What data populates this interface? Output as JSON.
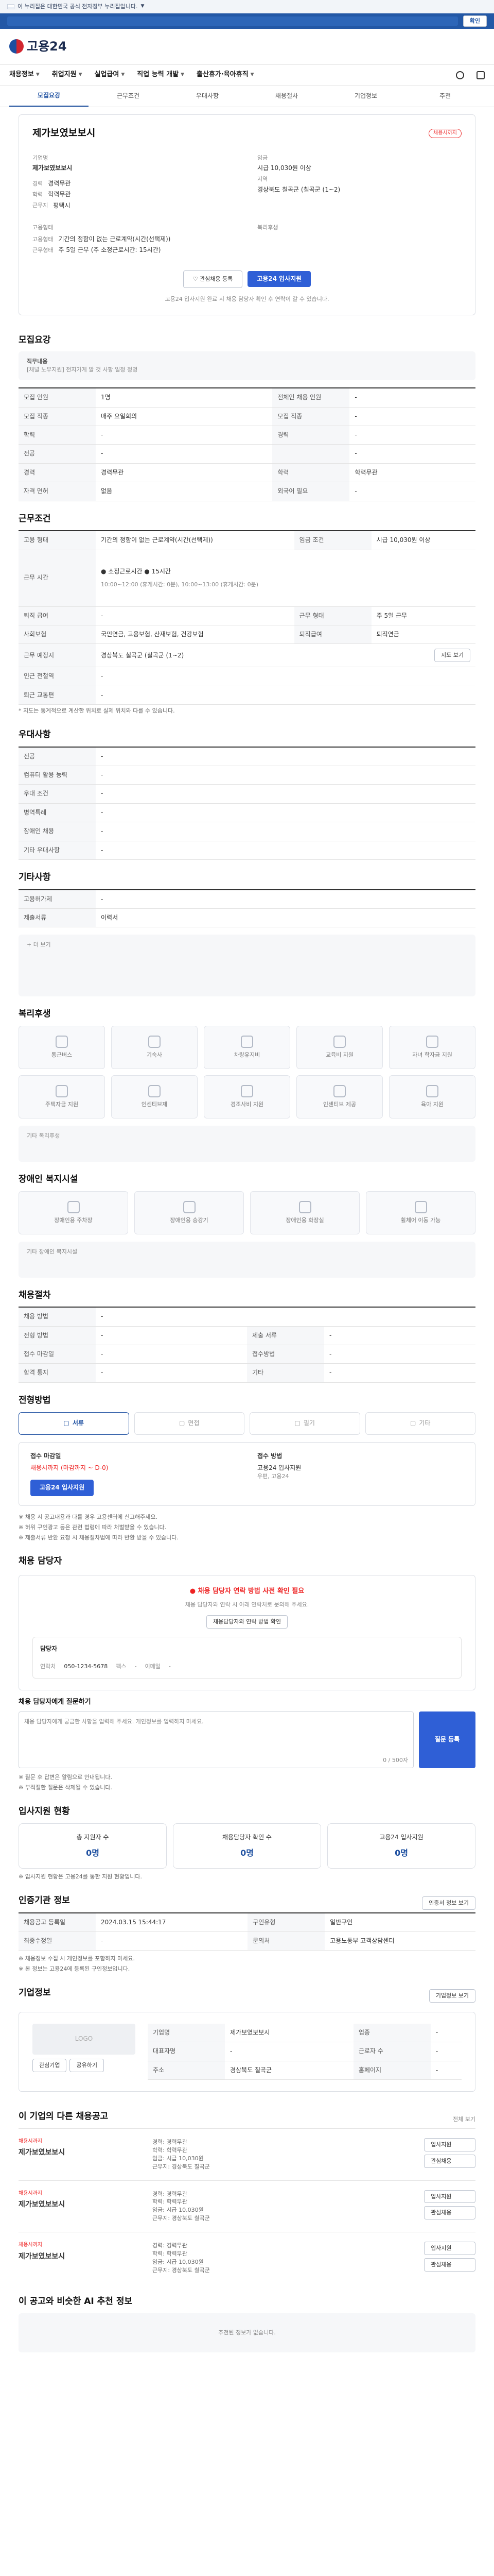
{
  "gov": {
    "banner": "이 누리집은 대한민국 공식 전자정부 누리집입니다.",
    "top_btn": "확인"
  },
  "brand": {
    "name": "고용24"
  },
  "gnb": {
    "items": [
      "채용정보",
      "취업지원",
      "실업급여",
      "직업 능력 개발",
      "출산휴가·육아휴직"
    ]
  },
  "tabs": [
    "모집요강",
    "근무조건",
    "우대사항",
    "채용절차",
    "기업정보",
    "추천"
  ],
  "job": {
    "badge": "채용시까지",
    "title": "제가보였보보시",
    "company_label": "기업명",
    "company": "제가보였보보시",
    "info": [
      [
        "경력",
        "경력무관"
      ],
      [
        "학력",
        "학력무관"
      ],
      [
        "근무지",
        "평택시"
      ]
    ],
    "salary_label": "임금",
    "salary": "시급 10,030원 이상",
    "region_label": "지역",
    "region": "경상북도 칠곡군 (칠곡군 (1~2)",
    "employ_label": "고용형태",
    "employ": [
      [
        "고용형태",
        "기간의 정함이 없는 근로계약(시간(선택제))"
      ],
      [
        "근무형태",
        "주 5일 근무 (주 소정근로시간: 15시간)"
      ]
    ],
    "manager_label": "복리후생",
    "btn_fav": "관심채용 등록",
    "btn_apply": "고용24 입사지원",
    "foot": "고용24 입사지원 완료 시 채용 담당자 확인 후 연락이 갈 수 있습니다."
  },
  "sec_recruit": {
    "title": "모집요강",
    "duty_label": "직무내용",
    "duty_text": "[채널 노무지원] 전지가게 알 것 사항 일정 정명",
    "rows": [
      [
        "모집 인원",
        "1명",
        "전체인 채용 인원",
        "-"
      ],
      [
        "모집 직종",
        "매주 요일희의",
        "모집 직종",
        "-"
      ],
      [
        "학력",
        "-",
        "경력",
        "-"
      ],
      [
        "전공",
        "-",
        "",
        "-"
      ],
      [
        "경력",
        "경력무관",
        "학력",
        "학력무관"
      ],
      [
        "자격 면허",
        "없음",
        "외국어 필요",
        "-"
      ]
    ]
  },
  "sec_cond": {
    "title": "근무조건",
    "rows": [
      [
        "고용 형태",
        "기간의 정함이 없는 근로계약(시간(선택제))",
        "임금 조건",
        "시급 10,030원 이상"
      ],
      [
        "근무 시간",
        "",
        "",
        ""
      ],
      [
        "퇴직 급여",
        "-",
        "근무 형태",
        "주 5일 근무"
      ],
      [
        "사회보험",
        "국민연금, 고용보험, 산재보험, 건강보험",
        "퇴직급여",
        "퇴직연금"
      ],
      [
        "근무 예정지",
        "경상북도 칠곡군 (칠곡군 (1~2)",
        "",
        ""
      ],
      [
        "인근 전철역",
        "-",
        "",
        ""
      ],
      [
        "퇴근 교통편",
        "-",
        "",
        ""
      ]
    ],
    "time": "● 소정근로시간 ● 15시간",
    "work": "10:00~12:00 (휴게시간: 0분), 10:00~13:00 (휴게시간: 0분)",
    "map_btn": "지도 보기",
    "note": "* 지도는 통계적으로 계산한 위치로 실제 위치와 다를 수 있습니다."
  },
  "sec_pref": {
    "title": "우대사항",
    "rows": [
      [
        "전공",
        "-"
      ],
      [
        "컴퓨터 활용 능력",
        "-"
      ],
      [
        "우대 조건",
        "-"
      ],
      [
        "병역특례",
        "-"
      ],
      [
        "장애인 채용",
        "-"
      ],
      [
        "기타 우대사항",
        "-"
      ]
    ]
  },
  "sec_etc": {
    "title": "기타사항",
    "rows": [
      [
        "고용허가제",
        "-"
      ],
      [
        "제출서류",
        "이력서"
      ]
    ],
    "more": "더 보기"
  },
  "sec_welf": {
    "title": "복리후생",
    "items": [
      "통근버스",
      "기숙사",
      "차량유지비",
      "교육비 지원",
      "자녀 학자금 지원",
      "주택자금 지원",
      "인센티브제",
      "경조사비 지원",
      "인센티브 제공",
      "육아 지원"
    ],
    "none": "기타 복리후생"
  },
  "sec_dis": {
    "title": "장애인 복지시설",
    "items": [
      "장애인용 주차장",
      "장애인용 승강기",
      "장애인용 화장실",
      "휠체어 이동 가능"
    ],
    "none": "기타 장애인 복지시설"
  },
  "sec_sel": {
    "title": "채용절차",
    "rows": [
      [
        "채용 방법",
        "-",
        "",
        ""
      ],
      [
        "전형 방법",
        "-",
        "제출 서류",
        "-"
      ],
      [
        "접수 마감일",
        "-",
        "접수방법",
        "-"
      ],
      [
        "합격 통지",
        "-",
        "기타",
        "-"
      ]
    ]
  },
  "sec_apply": {
    "title": "전형방법",
    "chips": [
      "서류",
      "면접",
      "필기",
      "기타"
    ],
    "deadline_label": "접수 마감일",
    "deadline": "채용시까지 (마감까지 ~ D-0)",
    "method_label": "접수 방법",
    "method": "고용24 입사지원",
    "method2": "우편, 고용24",
    "btn": "고용24 입사지원",
    "notes": [
      "※ 채용 시 공고내용과 다를 경우 고용센터에 신고해주세요.",
      "※ 허위 구인광고 등은 관련 법령에 따라 처벌받을 수 있습니다.",
      "※ 제출서류 반환 요청 시 채용절차법에 따라 반환 받을 수 있습니다."
    ]
  },
  "sec_mgr": {
    "title": "채용 담당자",
    "alert": "채용 담당자 연락 방법 사전 확인 필요",
    "desc": "채용 담당자와 연락 시 아래 연락처로 문의해 주세요.",
    "btn_check": "채용담당자와 연락 방법 확인",
    "name_label": "담당자",
    "contact_label": "연락처",
    "contact": "050-1234-5678",
    "fax_label": "팩스",
    "fax": "-",
    "email_label": "이메일",
    "email": "-",
    "mail_label": "우편 주소",
    "q_title": "채용 담당자에게 질문하기",
    "q_hint": "채용 담당자에게 궁금한 사항을 입력해 주세요. 개인정보를 입력하지 마세요.",
    "q_count": "0 / 500자",
    "q_btn": "질문 등록",
    "q_notes": [
      "※ 질문 후 답변은 알림으로 안내됩니다.",
      "※ 부적절한 질문은 삭제될 수 있습니다."
    ]
  },
  "sec_stat": {
    "title": "입사지원 현황",
    "items": [
      [
        "총 지원자 수",
        "0명"
      ],
      [
        "채용담당자 확인 수",
        "0명"
      ],
      [
        "고용24 입사지원",
        "0명"
      ]
    ],
    "note": "※ 입사지원 현황은 고용24를 통한 지원 현황입니다."
  },
  "sec_info": {
    "title": "인증기관 정보",
    "btn": "인증서 정보 보기",
    "rows": [
      [
        "채용공고 등록일",
        "2024.03.15 15:44:17",
        "구인유형",
        "일반구인"
      ],
      [
        "최종수정일",
        "-",
        "문의처",
        "고용노동부 고객상담센터"
      ]
    ],
    "notes": [
      "※ 채용정보 수집 시 개인정보를 포함하지 마세요.",
      "※ 본 정보는 고용24에 등록된 구인정보입니다."
    ]
  },
  "sec_corp": {
    "title": "기업정보",
    "btn": "기업정보 보기",
    "logo": "LOGO",
    "rows": [
      [
        "기업명",
        "제가보였보보시",
        "업종",
        "-"
      ],
      [
        "대표자명",
        "-",
        "근로자 수",
        "-"
      ],
      [
        "주소",
        "경상북도 칠곡군",
        "홈페이지",
        "-"
      ]
    ],
    "btn_fav": "관심기업",
    "btn_share": "공유하기"
  },
  "sec_rel": {
    "title": "이 기업의 다른 채용공고",
    "more": "전체 보기",
    "jobs": [
      {
        "badge": "채용시까지",
        "title": "제가보였보보시",
        "lines": [
          "경력: 경력무관",
          "학력: 학력무관",
          "임금: 시급 10,030원",
          "근무지: 경상북도 칠곡군"
        ],
        "btns": [
          "입사지원",
          "관심채용"
        ]
      },
      {
        "badge": "채용시까지",
        "title": "제가보였보보시",
        "lines": [
          "경력: 경력무관",
          "학력: 학력무관",
          "임금: 시급 10,030원",
          "근무지: 경상북도 칠곡군"
        ],
        "btns": [
          "입사지원",
          "관심채용"
        ]
      },
      {
        "badge": "채용시까지",
        "title": "제가보였보보시",
        "lines": [
          "경력: 경력무관",
          "학력: 학력무관",
          "임금: 시급 10,030원",
          "근무지: 경상북도 칠곡군"
        ],
        "btns": [
          "입사지원",
          "관심채용"
        ]
      }
    ]
  },
  "sec_ai": {
    "title": "이 공고와 비슷한 AI 추천 정보",
    "empty": "추천된 정보가 없습니다."
  }
}
